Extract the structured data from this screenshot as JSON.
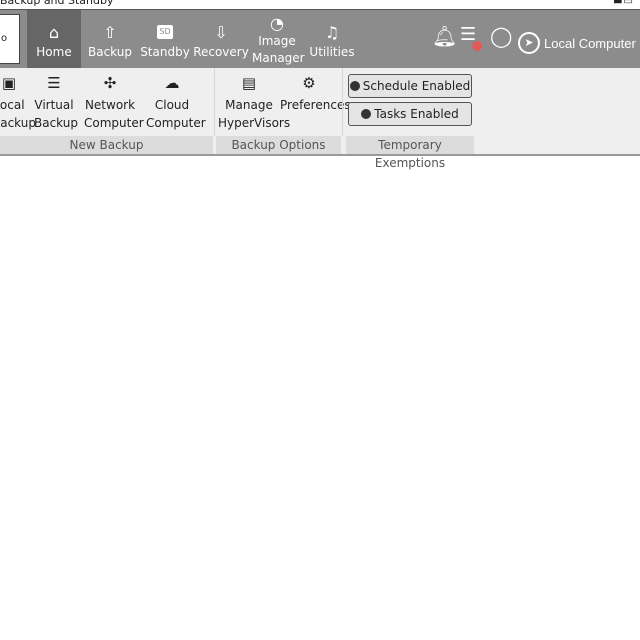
{
  "window": {
    "title": "Backup and Standby"
  },
  "nav": {
    "items": [
      {
        "label": "Home",
        "icon": "home-icon",
        "active": true
      },
      {
        "label": "Backup",
        "icon": "upload-icon"
      },
      {
        "label": "Standby",
        "icon": "sd-card-icon",
        "icon_text": "SD"
      },
      {
        "label": "Recovery",
        "icon": "download-icon"
      },
      {
        "label": "Image Manager",
        "icon": "pie-chart-icon"
      },
      {
        "label": "Utilities",
        "icon": "lamp-icon"
      }
    ],
    "notification_badge_color": "#e25a5a",
    "location": "Local Computer"
  },
  "ribbon": {
    "groups": [
      {
        "label": "New Backup",
        "buttons": [
          {
            "label1": "Local",
            "label2": "Backup",
            "icon": "computer-icon"
          },
          {
            "label1": "Virtual",
            "label2": "Backup",
            "icon": "server-icon"
          },
          {
            "label1": "Network",
            "label2": "Computer",
            "icon": "network-icon"
          },
          {
            "label1": "Cloud",
            "label2": "Computer",
            "icon": "cloud-icon"
          }
        ]
      },
      {
        "label": "Backup Options",
        "buttons": [
          {
            "label1": "Manage",
            "label2": "HyperVisors",
            "icon": "hypervisor-icon"
          },
          {
            "label1": "Preferences",
            "label2": "",
            "icon": "gears-icon"
          }
        ]
      },
      {
        "label": "Temporary Exemptions",
        "toggles": [
          {
            "label": "Schedule Enabled",
            "on": true
          },
          {
            "label": "Tasks Enabled",
            "on": true
          }
        ]
      }
    ]
  }
}
